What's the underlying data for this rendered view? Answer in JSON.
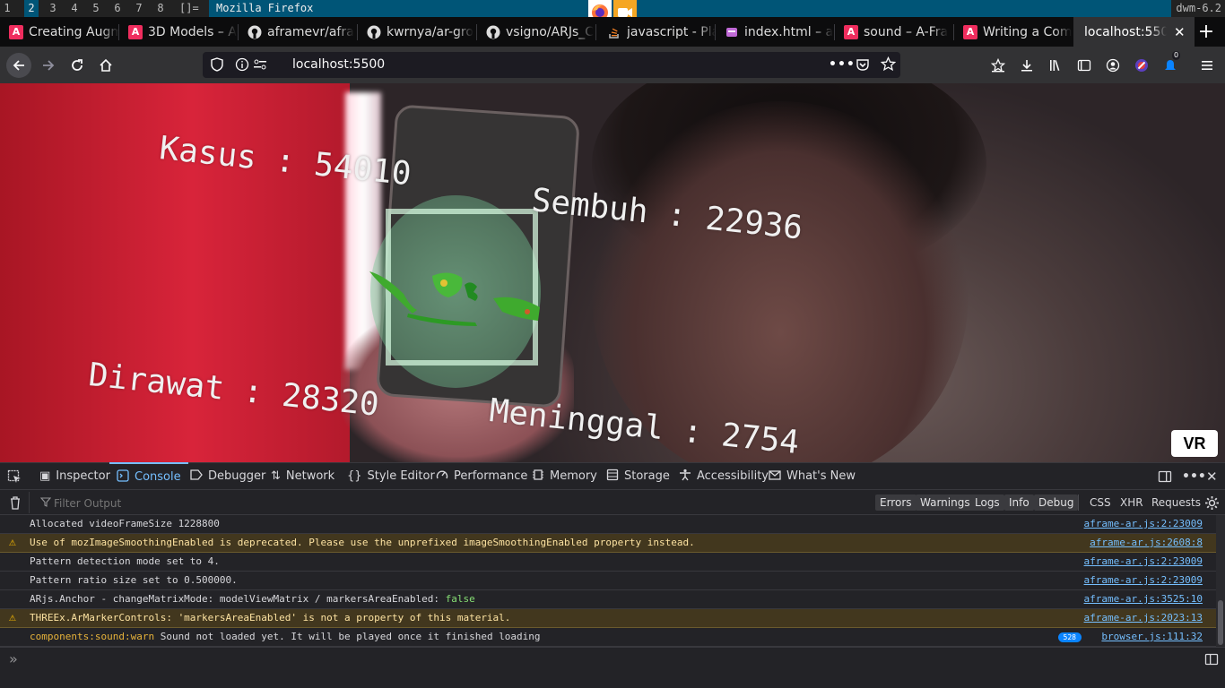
{
  "dwm": {
    "tags": [
      "1",
      "2",
      "3",
      "4",
      "5",
      "6",
      "7",
      "8"
    ],
    "selected_tag": "2",
    "layout": "[]=",
    "window_title": "Mozilla Firefox",
    "status": "dwm-6.2"
  },
  "tabs": [
    {
      "label": "Creating Augm",
      "favicon": "aframe-icon"
    },
    {
      "label": "3D Models – A",
      "favicon": "aframe-icon"
    },
    {
      "label": "aframevr/afra",
      "favicon": "github-icon"
    },
    {
      "label": "kwrnya/ar-gro",
      "favicon": "github-icon"
    },
    {
      "label": "vsigno/ARJs_C",
      "favicon": "github-icon"
    },
    {
      "label": "javascript - Pla",
      "favicon": "stackoverflow-icon"
    },
    {
      "label": "index.html – a",
      "favicon": "glitch-icon"
    },
    {
      "label": "sound – A-Fra",
      "favicon": "aframe-icon"
    },
    {
      "label": "Writing a Com",
      "favicon": "aframe-icon"
    },
    {
      "label": "localhost:5500",
      "favicon": "",
      "active": true
    }
  ],
  "nav": {
    "url": "localhost:5500",
    "notification_count": "0"
  },
  "ar": {
    "kasus": "Kasus : 54010",
    "sembuh": "Sembuh : 22936",
    "dirawat": "Dirawat : 28320",
    "meninggal": "Meninggal : 2754",
    "vr_button": "VR"
  },
  "devtools": {
    "tabs": [
      "Inspector",
      "Console",
      "Debugger",
      "Network",
      "Style Editor",
      "Performance",
      "Memory",
      "Storage",
      "Accessibility",
      "What's New"
    ],
    "selected": "Console",
    "filter_placeholder": "Filter Output",
    "levels": [
      "Errors",
      "Warnings",
      "Logs",
      "Info",
      "Debug"
    ],
    "types": [
      "CSS",
      "XHR",
      "Requests"
    ],
    "messages": [
      {
        "type": "log",
        "text": "Allocated videoFrameSize 1228800",
        "source": "aframe-ar.js:2:23009"
      },
      {
        "type": "warn",
        "text": "Use of mozImageSmoothingEnabled is deprecated. Please use the unprefixed imageSmoothingEnabled property instead.",
        "source": "aframe-ar.js:2608:8"
      },
      {
        "type": "log",
        "text": "Pattern detection mode set to 4.",
        "source": "aframe-ar.js:2:23009"
      },
      {
        "type": "log",
        "text": "Pattern ratio size set to 0.500000.",
        "source": "aframe-ar.js:2:23009"
      },
      {
        "type": "log",
        "text_prefix": "ARjs.Anchor - changeMatrixMode: modelViewMatrix / markersAreaEnabled:",
        "text_value": "false",
        "source": "aframe-ar.js:3525:10"
      },
      {
        "type": "warn",
        "text": "THREEx.ArMarkerControls: 'markersAreaEnabled' is not a property of this material.",
        "source": "aframe-ar.js:2023:13"
      },
      {
        "type": "log",
        "text_prefix": "components:sound:warn",
        "text_value": "Sound not loaded yet. It will be played once it finished loading",
        "repeat": "528",
        "source": "browser.js:111:32"
      }
    ],
    "prompt": "»"
  }
}
